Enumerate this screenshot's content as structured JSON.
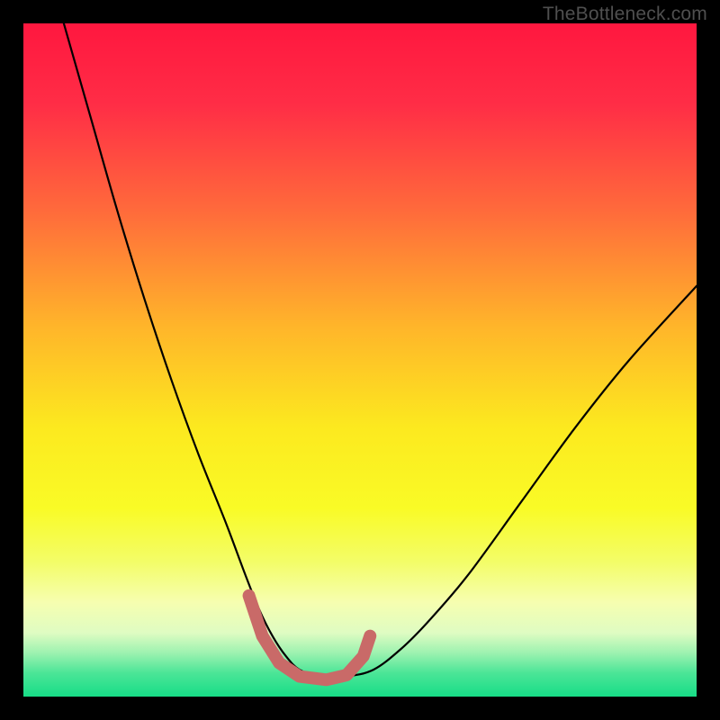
{
  "watermark": "TheBottleneck.com",
  "colors": {
    "trough_stroke": "#c96a68",
    "curve_stroke": "#000000",
    "gradient_stops": [
      {
        "offset": 0.0,
        "color": "#ff173f"
      },
      {
        "offset": 0.12,
        "color": "#ff2d46"
      },
      {
        "offset": 0.28,
        "color": "#ff6b3b"
      },
      {
        "offset": 0.45,
        "color": "#ffb52a"
      },
      {
        "offset": 0.6,
        "color": "#fce91f"
      },
      {
        "offset": 0.72,
        "color": "#f9fb26"
      },
      {
        "offset": 0.8,
        "color": "#f3fd68"
      },
      {
        "offset": 0.86,
        "color": "#f6feb0"
      },
      {
        "offset": 0.905,
        "color": "#dffcc2"
      },
      {
        "offset": 0.935,
        "color": "#9df2b0"
      },
      {
        "offset": 0.965,
        "color": "#4be597"
      },
      {
        "offset": 1.0,
        "color": "#17dd87"
      }
    ]
  },
  "chart_data": {
    "type": "line",
    "title": "",
    "xlabel": "",
    "ylabel": "",
    "xlim": [
      0,
      100
    ],
    "ylim": [
      0,
      100
    ],
    "series": [
      {
        "name": "bottleneck-curve",
        "x": [
          6,
          10,
          14,
          18,
          22,
          26,
          30,
          33,
          35,
          37,
          39,
          41,
          44,
          48,
          52,
          56,
          60,
          66,
          74,
          82,
          90,
          100
        ],
        "y": [
          100,
          86,
          72,
          59,
          47,
          36,
          26,
          18,
          13,
          9,
          6,
          4,
          3,
          3,
          4,
          7,
          11,
          18,
          29,
          40,
          50,
          61
        ]
      }
    ],
    "trough_range_x": [
      33,
      51
    ],
    "trough_path": [
      {
        "x": 33.5,
        "y": 15
      },
      {
        "x": 35.5,
        "y": 9
      },
      {
        "x": 38.0,
        "y": 5
      },
      {
        "x": 41.0,
        "y": 3
      },
      {
        "x": 45.0,
        "y": 2.5
      },
      {
        "x": 48.0,
        "y": 3.2
      },
      {
        "x": 50.5,
        "y": 6
      },
      {
        "x": 51.5,
        "y": 9
      }
    ]
  }
}
